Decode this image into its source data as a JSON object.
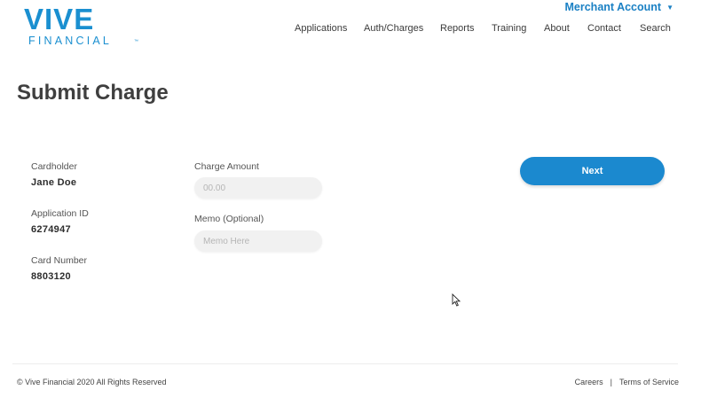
{
  "brand": {
    "name_top": "VIVE",
    "name_bottom": "FINANCIAL",
    "trademark": "™",
    "color": "#1a8fd0"
  },
  "header": {
    "account_label": "Merchant Account",
    "account_icon": "chevron-down-icon",
    "nav": [
      "Applications",
      "Auth/Charges",
      "Reports",
      "Training",
      "About",
      "Contact",
      "Search"
    ]
  },
  "page": {
    "title": "Submit Charge"
  },
  "details": {
    "cardholder_label": "Cardholder",
    "cardholder_value": "Jane Doe",
    "application_id_label": "Application ID",
    "application_id_value": "6274947",
    "card_number_label": "Card Number",
    "card_number_value": "8803120"
  },
  "form": {
    "charge_amount_label": "Charge Amount",
    "charge_amount_placeholder": "00.00",
    "memo_label": "Memo (Optional)",
    "memo_placeholder": "Memo Here",
    "next_label": "Next",
    "button_color": "#1b89cf"
  },
  "footer": {
    "copyright": "© Vive Financial 2020 All Rights Reserved",
    "links": [
      "Careers",
      "Terms of Service"
    ],
    "separator": "|"
  }
}
